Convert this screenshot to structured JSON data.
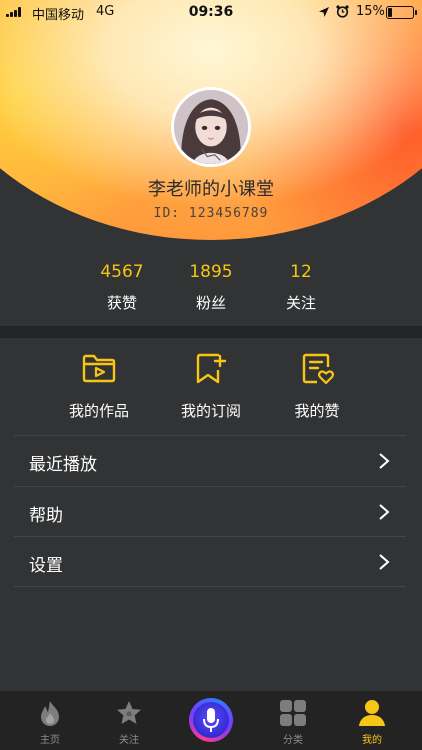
{
  "status_bar": {
    "carrier": "中国移动",
    "network": "4G",
    "time": "09:36",
    "battery_percent": "15%"
  },
  "profile": {
    "name": "李老师的小课堂",
    "id_text": "ID: 123456789"
  },
  "stats": [
    {
      "value": "4567",
      "label": "获赞"
    },
    {
      "value": "1895",
      "label": "粉丝"
    },
    {
      "value": "12",
      "label": "关注"
    }
  ],
  "quick_actions": [
    {
      "label": "我的作品",
      "icon": "folder-play-icon"
    },
    {
      "label": "我的订阅",
      "icon": "bookmark-plus-icon"
    },
    {
      "label": "我的赞",
      "icon": "note-heart-icon"
    }
  ],
  "menu": [
    {
      "label": "最近播放"
    },
    {
      "label": "帮助"
    },
    {
      "label": "设置"
    }
  ],
  "tabs": [
    {
      "label": "主页",
      "icon": "flame-icon"
    },
    {
      "label": "关注",
      "icon": "star-icon"
    },
    {
      "label": "",
      "icon": "microphone-icon"
    },
    {
      "label": "分类",
      "icon": "grid-icon"
    },
    {
      "label": "我的",
      "icon": "user-icon"
    }
  ],
  "colors": {
    "accent": "#f7c515",
    "background": "#323334",
    "tabbar": "#232323"
  }
}
